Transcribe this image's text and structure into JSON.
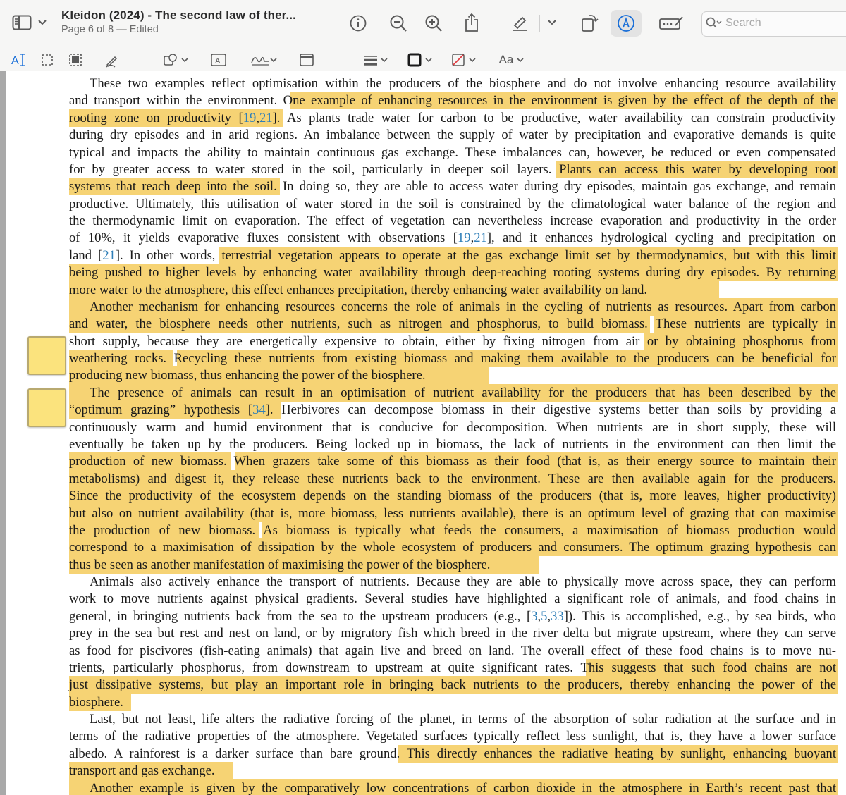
{
  "window": {
    "title": "Kleidon (2024) - The second law of ther...",
    "subtitle": "Page 6 of 8 — Edited",
    "search_placeholder": "Search"
  },
  "toolbar_icons": [
    "sidebar-icon",
    "chevron-down-icon",
    "info-icon",
    "zoom-out-icon",
    "zoom-in-icon",
    "share-icon",
    "highlighter-icon",
    "chevron-down-icon",
    "rotate-icon",
    "markup-icon",
    "form-fill-icon",
    "search-icon"
  ],
  "markup_icons": [
    "text-selection-icon",
    "rect-selection-icon",
    "lasso-selection-icon",
    "sketch-icon",
    "shapes-icon",
    "textbox-icon",
    "sign-icon",
    "note-icon",
    "line-style-icon",
    "border-color-icon",
    "fill-color-icon",
    "font-style-icon"
  ],
  "markup_font_label": "Aa",
  "colors": {
    "highlight": "#f6d374",
    "note": "#fbe37d",
    "reference": "#2f7fb8"
  },
  "lines": [
    [
      "These two examples reflect optimisation within the producers of the biosphere and do not involve enhancing resource availability"
    ],
    [
      "and transport within the environment. One example of enhancing resources in the environment is given by the effect of the depth of the"
    ],
    [
      "rooting zone on productivity [",
      "19",
      ",",
      "21",
      "]. As plants trade water for carbon to be productive, water availability can constrain productivity"
    ],
    [
      "during dry episodes and in arid regions. An imbalance between the supply of water by precipitation and evaporative demands is quite"
    ],
    [
      "typical and impacts the ability to maintain continuous gas exchange. These imbalances can, however, be reduced or even compensated"
    ],
    [
      "for by greater access to water stored in the soil, particularly in deeper soil layers. Plants can access this water by developing root"
    ],
    [
      "systems that reach deep into the soil. In doing so, they are able to access water during dry episodes, maintain gas exchange, and remain"
    ],
    [
      "productive. Ultimately, this utilisation of water stored in the soil is constrained by the climatological water balance of the region and"
    ],
    [
      "the thermodynamic limit on evaporation. The effect of vegetation can nevertheless increase evaporation and productivity in the order"
    ],
    [
      "of 10%, it yields evaporative fluxes consistent with observations [",
      "19",
      ",",
      "21",
      "], and it enhances hydrological cycling and precipitation on"
    ],
    [
      "land [",
      "21",
      "]. In other words, terrestrial vegetation appears to operate at the gas exchange limit set by thermodynamics, but with this limit"
    ],
    [
      "being pushed to higher levels by enhancing water availability through deep-reaching rooting systems during dry episodes. By returning"
    ],
    [
      "more water to the atmosphere, this effect enhances precipitation, thereby enhancing water availability on land."
    ],
    [
      "Another mechanism for enhancing resources concerns the role of animals in the cycling of nutrients as resources. Apart from carbon"
    ],
    [
      "and water, the biosphere needs other nutrients, such as nitrogen and phosphorus, to build biomass. These nutrients are typically in"
    ],
    [
      "short supply, because they are energetically expensive to obtain, either by fixing nitrogen from air or by obtaining phosphorus from"
    ],
    [
      "weathering rocks. Recycling these nutrients from existing biomass and making them available to the producers can be beneficial for"
    ],
    [
      "producing new biomass, thus enhancing the power of the biosphere."
    ],
    [
      "The presence of animals can result in an optimisation of nutrient availability for the producers that has been described by the"
    ],
    [
      "“optimum grazing” hypothesis [",
      "34",
      "]. Herbivores can decompose biomass in their digestive systems better than soils by providing a"
    ],
    [
      "continuously warm and humid environment that is conducive for decomposition. When nutrients are in short supply, these will"
    ],
    [
      "eventually be taken up by the producers. Being locked up in biomass, the lack of nutrients in the environment can then limit the"
    ],
    [
      "production of new biomass. When grazers take some of this biomass as their food (that is, as their energy source to maintain their"
    ],
    [
      "metabolisms) and digest it, they release these nutrients back to the environment. These are then available again for the producers."
    ],
    [
      "Since the productivity of the ecosystem depends on the standing biomass of the producers (that is, more leaves, higher productivity)"
    ],
    [
      "but also on nutrient availability (that is, more biomass, less nutrients available), there is an optimum level of grazing that can maximise"
    ],
    [
      "the production of new biomass. As biomass is typically what feeds the consumers, a maximisation of biomass production would"
    ],
    [
      "correspond to a maximisation of dissipation by the whole ecosystem of producers and consumers. The optimum grazing hypothesis can"
    ],
    [
      "thus be seen as another manifestation of maximising the power of the biosphere."
    ],
    [
      "Animals also actively enhance the transport of nutrients. Because they are able to physically move across space, they can perform"
    ],
    [
      "work to move nutrients against physical gradients. Several studies have highlighted a significant role of animals, and food chains in"
    ],
    [
      "general, in bringing nutrients back from the sea to the upstream producers (e.g., [",
      "3",
      ",",
      "5",
      ",",
      "33",
      "]). This is accomplished, e.g., by sea birds, who"
    ],
    [
      "prey in the sea but rest and nest on land, or by migratory fish which breed in the river delta but migrate upstream, where they can serve"
    ],
    [
      "as food for piscivores (fish-eating animals) that again live and breed on land. The overall effect of these food chains is to move nu-"
    ],
    [
      "trients, particularly phosphorus, from downstream to upstream at quite significant rates. This suggests that such food chains are not"
    ],
    [
      "just dissipative systems, but play an important role in bringing back nutrients to the producers, thereby enhancing the power of the"
    ],
    [
      "biosphere."
    ],
    [
      "Last, but not least, life alters the radiative forcing of the planet, in terms of the absorption of solar radiation at the surface and in"
    ],
    [
      "terms of the radiative properties of the atmosphere. Vegetated surfaces typically reflect less sunlight, that is, they have a lower surface"
    ],
    [
      "albedo. A rainforest is a darker surface than bare ground. This directly enhances the radiative heating by sunlight, enhancing buoyant"
    ],
    [
      "transport and gas exchange."
    ],
    [
      "Another example is given by the comparatively low concentrations of carbon dioxide in the atmosphere in Earth’s recent past that"
    ]
  ]
}
